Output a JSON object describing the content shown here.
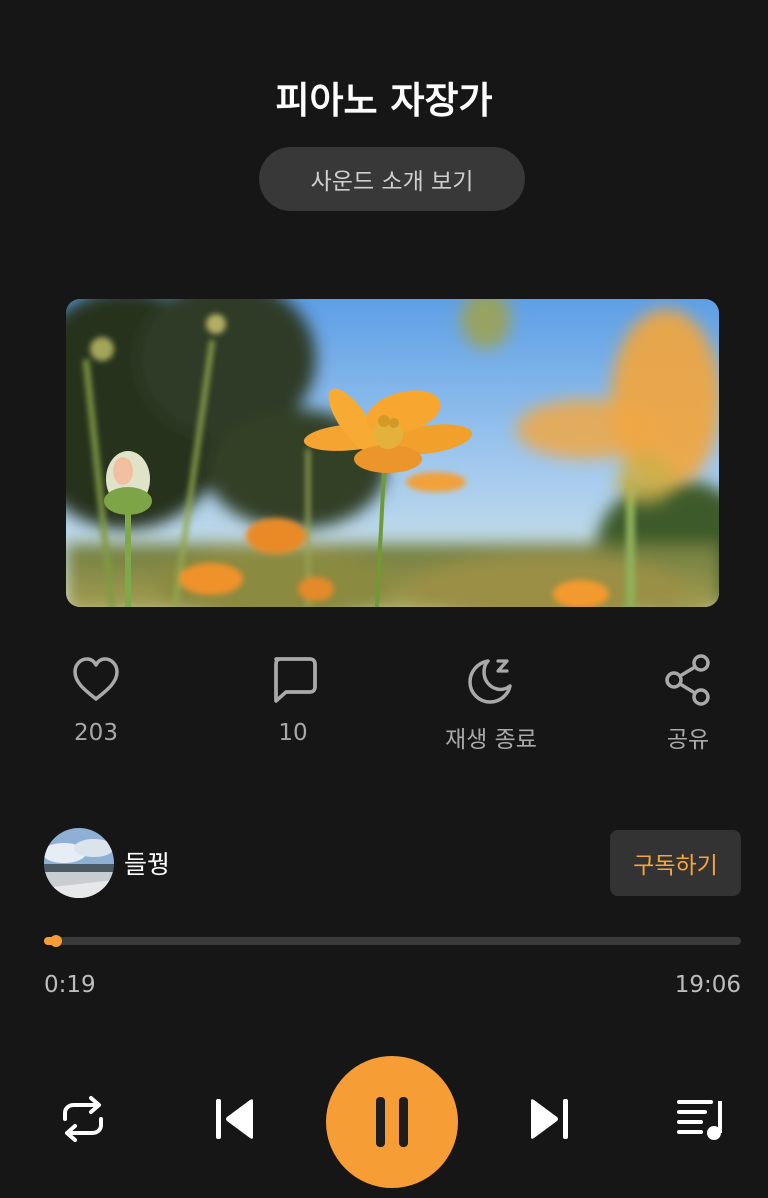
{
  "header": {
    "title": "피아노 자장가",
    "intro_button": "사운드 소개 보기"
  },
  "actions": {
    "like_count": "203",
    "comment_count": "10",
    "sleep_timer_label": "재생 종료",
    "share_label": "공유"
  },
  "creator": {
    "name": "들꿩",
    "subscribe_label": "구독하기"
  },
  "player": {
    "current_time": "0:19",
    "total_time": "19:06",
    "progress_percent": 1.7,
    "state": "playing"
  },
  "icons": [
    "heart-icon",
    "comment-icon",
    "moon-sleep-icon",
    "share-icon",
    "repeat-icon",
    "previous-icon",
    "pause-icon",
    "next-icon",
    "playlist-icon"
  ],
  "colors": {
    "accent": "#f79d36",
    "background": "#161616",
    "button_bg": "#383838",
    "muted_text": "#a9a9a9"
  }
}
